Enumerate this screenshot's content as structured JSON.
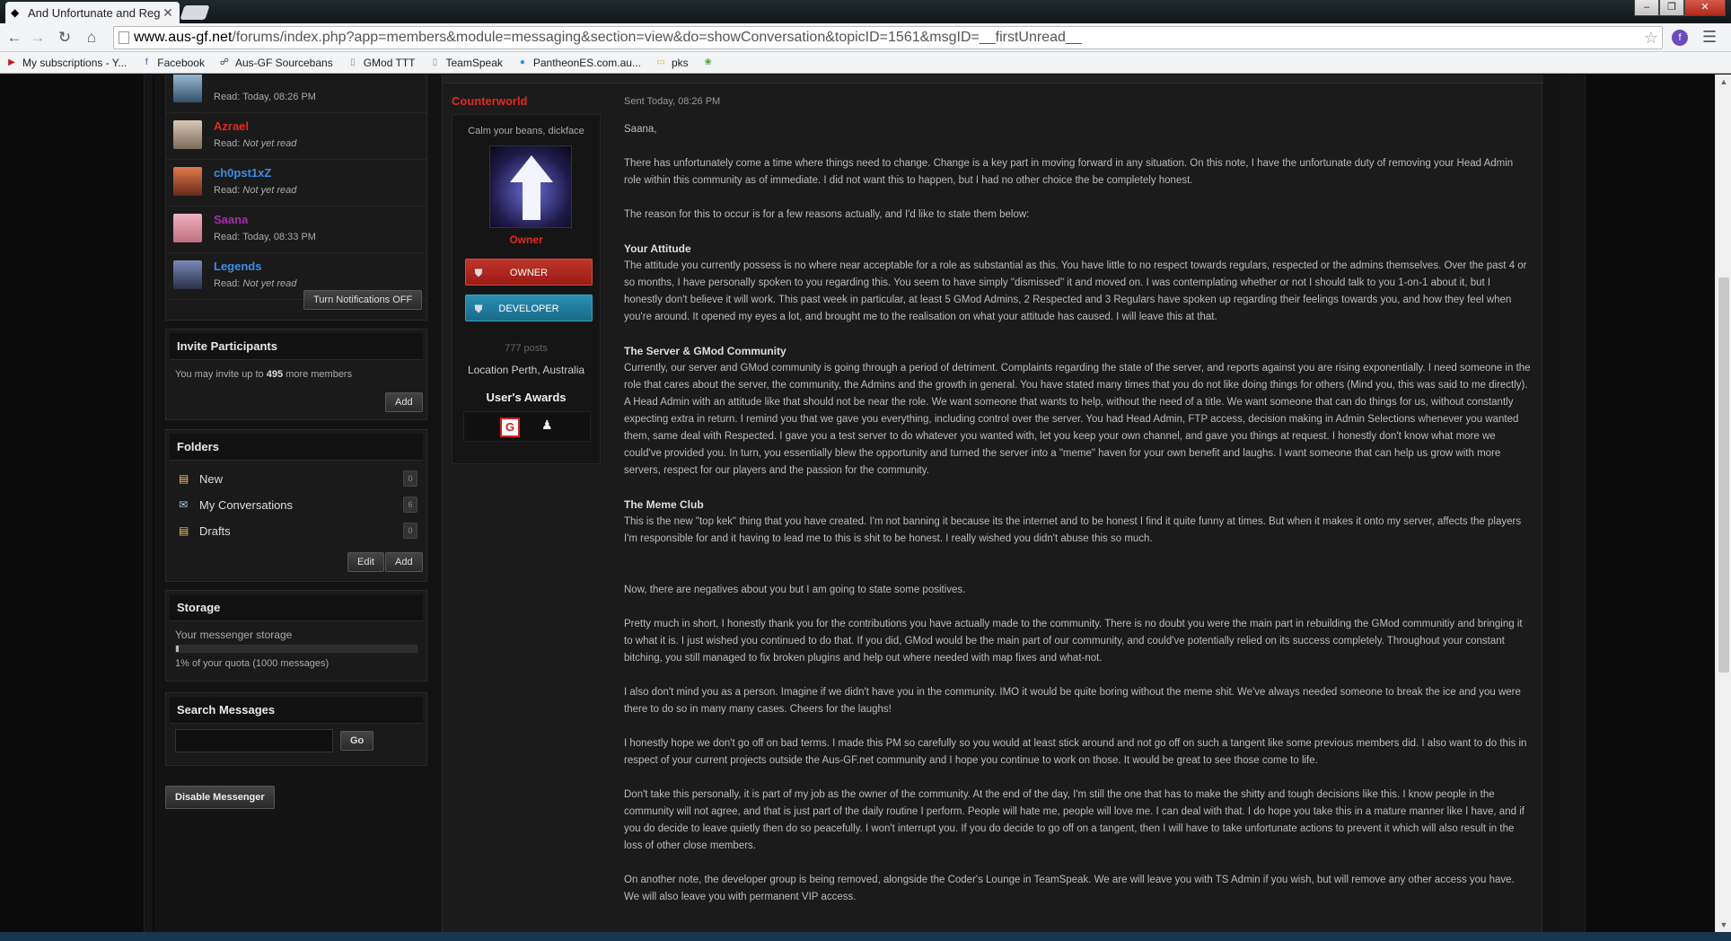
{
  "browser": {
    "tab_title": "And Unfortunate and Reg",
    "url_host": "www.aus-gf.net",
    "url_path": "/forums/index.php?app=members&module=messaging&section=view&do=showConversation&topicID=1561&msgID=__firstUnread__",
    "bookmarks": [
      {
        "label": "My subscriptions - Y...",
        "icon": "youtube-icon",
        "color": "#cc181e"
      },
      {
        "label": "Facebook",
        "icon": "facebook-icon",
        "color": "#3b5998"
      },
      {
        "label": "Aus-GF Sourcebans",
        "icon": "sourcebans-icon",
        "color": "#333333"
      },
      {
        "label": "GMod TTT",
        "icon": "page-icon",
        "color": "#888888"
      },
      {
        "label": "TeamSpeak",
        "icon": "page-icon",
        "color": "#888888"
      },
      {
        "label": "PantheonES.com.au...",
        "icon": "pantheon-icon",
        "color": "#2a8fd8"
      },
      {
        "label": "pks",
        "icon": "folder-icon",
        "color": "#e0b030"
      }
    ]
  },
  "readers": [
    {
      "name": "",
      "status_prefix": "Read: ",
      "status": "Today, 08:26 PM",
      "italic": false,
      "color": "#3a8ee6"
    },
    {
      "name": "Azrael",
      "status_prefix": "Read: ",
      "status": "Not yet read",
      "italic": true,
      "color": "#e02a1f"
    },
    {
      "name": "ch0pst1xZ",
      "status_prefix": "Read: ",
      "status": "Not yet read",
      "italic": true,
      "color": "#3a8ee6"
    },
    {
      "name": "Saana",
      "status_prefix": "Read: ",
      "status": "Today, 08:33 PM",
      "italic": false,
      "color": "#a22fa8"
    },
    {
      "name": "Legends",
      "status_prefix": "Read: ",
      "status": "Not yet read",
      "italic": true,
      "color": "#3a8ee6"
    }
  ],
  "notifications_button": "Turn Notifications OFF",
  "invite": {
    "title": "Invite Participants",
    "text_before": "You may invite up to ",
    "count": "495",
    "text_after": " more members",
    "add": "Add"
  },
  "folders": {
    "title": "Folders",
    "items": [
      {
        "label": "New",
        "count": "0"
      },
      {
        "label": "My Conversations",
        "count": "6"
      },
      {
        "label": "Drafts",
        "count": "0"
      }
    ],
    "edit": "Edit",
    "add": "Add"
  },
  "storage": {
    "title": "Storage",
    "label": "Your messenger storage",
    "percent": 1,
    "quota_text": "1% of your quota (1000 messages)"
  },
  "search": {
    "title": "Search Messages",
    "go": "Go"
  },
  "disable_messenger": "Disable Messenger",
  "message": {
    "author": "Counterworld",
    "sent": "Sent Today, 08:26 PM",
    "member_title": "Calm your beans, dickface",
    "group": "Owner",
    "badge_owner": "OWNER",
    "badge_developer": "DEVELOPER",
    "posts": "777 posts",
    "location": "Location Perth, Australia",
    "awards_heading": "User's Awards",
    "greeting": "Saana,",
    "p1": "There has unfortunately come a time where things need to change. Change is a key part in moving forward in any situation. On this note, I have the unfortunate duty of removing your Head Admin role within this community as of immediate. I did not want this to happen, but I had no other choice the be completely honest.",
    "p2": "The reason for this to occur is for a few reasons actually, and I'd like to state them below:",
    "h1": "Your Attitude",
    "p3": "The attitude you currently possess is no where near acceptable for a role as substantial as this. You have little to no respect towards regulars, respected or the admins themselves. Over the past 4 or so months, I have personally spoken to you regarding this. You seem to have simply \"dismissed\" it and moved on. I was contemplating whether or not I should talk to you 1-on-1 about it, but I honestly don't believe it will work. This past week in particular, at least 5 GMod Admins, 2 Respected and 3 Regulars have spoken up regarding their feelings towards you, and how they feel when you're around. It opened my eyes a lot, and brought me to the realisation on what your attitude has caused. I will leave this at that.",
    "h2": "The Server & GMod Community",
    "p4": "Currently, our server and GMod community is going through a period of detriment. Complaints regarding the state of the server, and reports against you are rising exponentially. I need someone in the role that cares about the server, the community, the Admins and the growth in general. You have stated many times that you do not like doing things for others (Mind you, this was said to me directly). A Head Admin with an attitude like that should not be near the role. We want someone that wants to help, without the need of a title. We want someone that can do things for us, without constantly expecting extra in return. I remind you that we gave you everything, including control over the server. You had Head Admin, FTP access, decision making in Admin Selections whenever you wanted them, same deal with Respected. I gave you a test server to do whatever you wanted with, let you keep your own channel, and gave you things at request. I honestly don't know what more we could've provided you. In turn, you essentially blew the opportunity and turned the server into a \"meme\" haven for your own benefit and laughs. I want someone that can help us grow with more servers, respect for our players and the passion for the community.",
    "h3": "The Meme Club",
    "p5": "This is the new \"top kek\" thing that you have created. I'm not banning it because its the internet and to be honest I find it quite funny at times. But when it makes it onto my server, affects the players I'm responsible for and it having to lead me to this is shit to be honest. I really wished you didn't abuse this so much.",
    "p6": "Now, there are negatives about you but I am going to state some positives.",
    "p7": "Pretty much in short, I honestly thank you for the contributions you have actually made to the community. There is no doubt you were the main part in rebuilding the GMod communitiy and bringing it to what it is. I just wished you continued to do that. If you did, GMod would be the main part of our community, and could've potentially relied on its success completely. Throughout your constant bitching, you still managed to fix broken plugins and help out where needed with map fixes and what-not.",
    "p8": "I also don't mind you as a person. Imagine if we didn't have you in the community. IMO it would be quite boring without the meme shit. We've always needed someone to break the ice and you were there to do so in many many cases. Cheers for the laughs!",
    "p9": "I honestly hope we don't go off on bad terms. I made this PM so carefully so you would at least stick around and not go off on such a tangent like some previous members did. I also want to do this in respect of your current projects outside the Aus-GF.net community and I hope you continue to work on those. It would be great to see those come to life.",
    "p10": "Don't take this personally, it is part of my job as the owner of the community. At the end of the day, I'm still the one that has to make the shitty and tough decisions like this. I know people in the community will not agree, and that is just part of the daily routine I perform. People will hate me, people will love me. I can deal with that. I do hope you take this in a mature manner like I have, and if you do decide to leave quietly then do so peacefully. I won't interrupt you. If you do decide to go off on a tangent, then I will have to take unfortunate actions to prevent it which will also result in the loss of other close members.",
    "p11": "On another note, the developer group is being removed, alongside the Coder's Lounge in TeamSpeak. We are will leave you with TS Admin if you wish, but will remove any other access you have. We will also leave you with permanent VIP access."
  }
}
